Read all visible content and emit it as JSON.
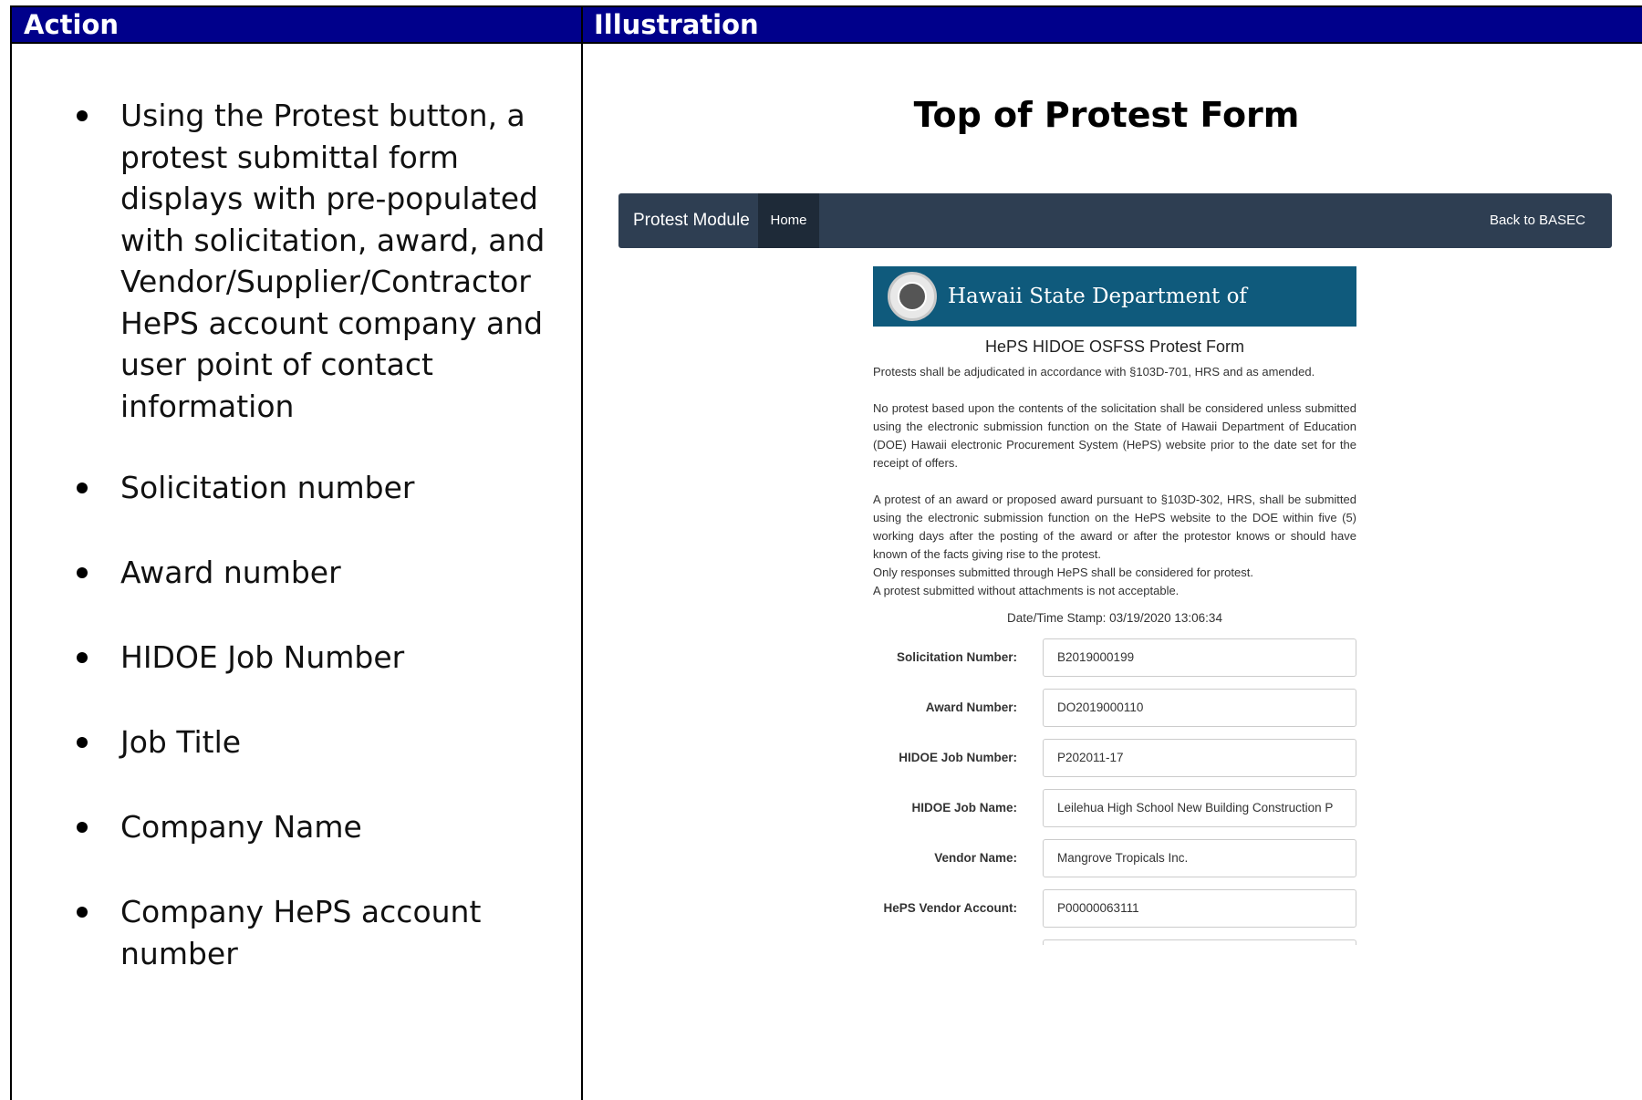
{
  "table": {
    "headers": {
      "action": "Action",
      "illustration": "Illustration"
    }
  },
  "action": {
    "bullets": [
      "Using the Protest button, a protest submittal form displays with pre-populated with solicitation, award, and Vendor/Supplier/Contractor HePS account company and user point of contact information",
      "Solicitation number",
      "Award number",
      "HIDOE Job Number",
      "Job Title",
      "Company Name",
      "Company HePS account number"
    ]
  },
  "illustration": {
    "title": "Top of Protest Form",
    "navbar": {
      "brand": "Protest Module",
      "home": "Home",
      "back": "Back to BASEC"
    },
    "banner": {
      "text": "Hawaii State Department of Education"
    },
    "form": {
      "title": "HePS HIDOE OSFSS Protest Form",
      "p1": "Protests shall be adjudicated in accordance with §103D-701, HRS and as amended.",
      "p2": "No protest based upon the contents of the solicitation shall be considered unless submitted using the electronic submission function on the State of Hawaii Department of Education (DOE) Hawaii electronic Procurement System (HePS) website prior to the date set for the receipt of offers.",
      "p3": "A protest of an award or proposed award pursuant to §103D-302, HRS, shall be submitted using the electronic submission function on the HePS website to the DOE within five (5) working days after the posting of the award or after the protestor knows or should have known of the facts giving rise to the protest.",
      "p4": "Only responses submitted through HePS shall be considered for protest.",
      "p5": "A protest submitted without attachments is not acceptable.",
      "timestamp": "Date/Time Stamp: 03/19/2020 13:06:34",
      "fields": [
        {
          "label": "Solicitation Number:",
          "value": "B2019000199"
        },
        {
          "label": "Award Number:",
          "value": "DO2019000110"
        },
        {
          "label": "HIDOE Job Number:",
          "value": "P202011-17"
        },
        {
          "label": "HIDOE Job Name:",
          "value": "Leilehua High School New Building Construction P"
        },
        {
          "label": "Vendor Name:",
          "value": "Mangrove Tropicals Inc."
        },
        {
          "label": "HePS Vendor Account:",
          "value": "P00000063111"
        }
      ]
    }
  },
  "colors": {
    "header_bg": "#00008b",
    "navbar_bg": "#2e3e52",
    "banner_bg": "#0f5a7c"
  },
  "icons": {
    "seal": "hawaii-doe-seal-icon"
  }
}
